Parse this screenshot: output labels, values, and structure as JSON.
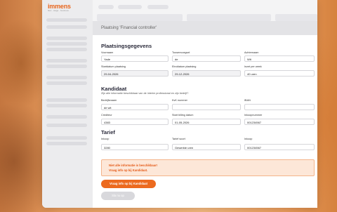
{
  "app": {
    "logo": "immens",
    "logo_tagline": "flexi · stage · business"
  },
  "page": {
    "title": "Plaatsing 'Financial controller'"
  },
  "placement": {
    "section_title": "Plaatsingsgegevens",
    "fields": [
      {
        "label": "Voornaam",
        "value": "Yade"
      },
      {
        "label": "Tussenvoegsel",
        "value": "de"
      },
      {
        "label": "Achternaam",
        "value": "Wit"
      },
      {
        "label": "Startdatum plaatsing",
        "value": "29-04-2026"
      },
      {
        "label": "Einddatum plaatsing",
        "value": "29-12-2026"
      },
      {
        "label": "Inzet per week",
        "value": "40 uren"
      }
    ]
  },
  "candidate": {
    "section_title": "Kandidaat",
    "hint": "Zijn alle informatie beschikbaar van de interim professional en zijn bedrijf?",
    "fields": [
      {
        "label": "Bedrijfsnaam",
        "value": "de wit"
      },
      {
        "label": "KvK nummer",
        "value": ""
      },
      {
        "label": "IBAN",
        "value": ""
      },
      {
        "label": "Crediteur",
        "value": "4383"
      },
      {
        "label": "Start billing datum",
        "value": "01-05-2026"
      },
      {
        "label": "Inkoopnummer",
        "value": "001234567"
      }
    ]
  },
  "rate": {
    "section_title": "Tarief",
    "fields": [
      {
        "label": "Inkoop",
        "value": "3280"
      },
      {
        "label": "Tarief soort",
        "value": "Gewerkte uren"
      },
      {
        "label": "Inkoop",
        "value": "001234567"
      }
    ]
  },
  "alert": {
    "line1": "Niet alle informatie is beschikbaar!",
    "line2": "Vraag info op bij Kandidaat."
  },
  "buttons": {
    "request_info": "Vraag info op bij Kandidaat",
    "save": "Sla nu op"
  }
}
